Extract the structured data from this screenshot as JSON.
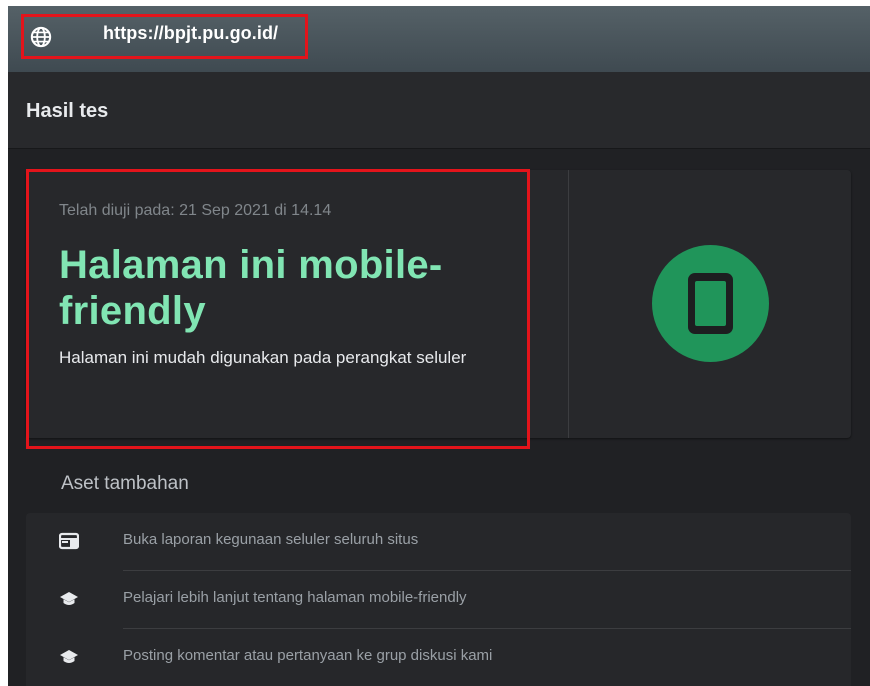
{
  "url_bar": {
    "url": "https://bpjt.pu.go.id/",
    "icon": "globe-icon"
  },
  "header": {
    "title": "Hasil tes"
  },
  "result_card": {
    "tested_on": "Telah diuji pada: 21 Sep 2021 di 14.14",
    "verdict": "Halaman ini mobile-friendly",
    "description": "Halaman ini mudah digunakan pada perangkat seluler",
    "badge_icon": "smartphone-icon",
    "verdict_color": "#81e5b3",
    "badge_color": "#20955a"
  },
  "additional_resources": {
    "title": "Aset tambahan",
    "items": [
      {
        "icon": "report-icon",
        "label": "Buka laporan kegunaan seluler seluruh situs"
      },
      {
        "icon": "school-icon",
        "label": "Pelajari lebih lanjut tentang halaman mobile-friendly"
      },
      {
        "icon": "school-icon",
        "label": "Posting komentar atau pertanyaan ke grup diskusi kami"
      }
    ]
  },
  "highlight_color": "#e3141b"
}
